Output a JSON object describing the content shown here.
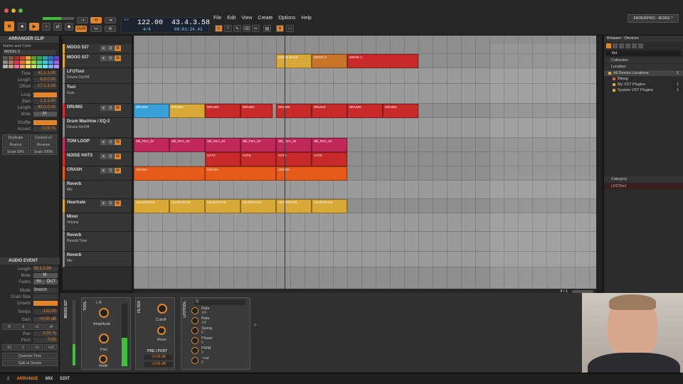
{
  "transport": {
    "tempo": "122.00",
    "signature": "4/4",
    "position": "43.4.3.58",
    "time": "00:01:24.41",
    "ovr": "OVR"
  },
  "menu": [
    "File",
    "Edit",
    "View",
    "Create",
    "Options",
    "Help"
  ],
  "project": {
    "name": "FADERPRO - BORG *"
  },
  "inspector": {
    "title": "ARRANGER CLIP",
    "name_color_label": "Name and Color",
    "clip_name": "MOOG 2",
    "fields": [
      {
        "k": "Time",
        "v": "41.1.1.00"
      },
      {
        "k": "Length",
        "v": "8.0.0.00"
      },
      {
        "k": "Offset",
        "v": "17.1.1.00"
      }
    ],
    "loop": [
      {
        "k": "Loop",
        "v": ""
      },
      {
        "k": "Start",
        "v": "1.1.1.00"
      },
      {
        "k": "Length",
        "v": "40.0.0.00"
      }
    ],
    "mute_label": "Mute",
    "mute_val": "M",
    "shuffle_label": "Shuffle",
    "accent_label": "Accent",
    "accent_val": "0.00 %",
    "buttons": [
      "Duplicate",
      "Content x2",
      "Bounce",
      "Reverse",
      "Scale 50%",
      "Scale 200%"
    ]
  },
  "audio_event": {
    "title": "AUDIO EVENT",
    "length_label": "Length",
    "length": "39.3.3.99",
    "mute_label": "Mute",
    "fades_label": "Fades",
    "fades_in": "IN",
    "fades_out": "OUT",
    "mode_label": "Mode",
    "mode": "Stretch",
    "grain_label": "Grain Size",
    "onsets_label": "Onsets",
    "tempo_label": "Tempo",
    "tempo": "122.00",
    "gain_label": "Gain",
    "gain": "+0.00 dB",
    "gain_steps": [
      "-6",
      "-1",
      "+1",
      "+6"
    ],
    "pan_label": "Pan",
    "pan": "0.00 %",
    "pitch_label": "Pitch",
    "pitch": "0.00",
    "pitch_steps": [
      "-12",
      "-1",
      "+1",
      "+12"
    ],
    "quantize": "Quantize Time",
    "split": "Split at Onsets"
  },
  "ruler": [
    "1",
    "5",
    "9",
    "13",
    "17",
    "21",
    "25",
    "29",
    "33",
    "37",
    "41",
    "45",
    "49",
    "53",
    "57",
    "61",
    "65",
    "69",
    "73",
    "77",
    "81",
    "85",
    "89",
    "93",
    "97",
    "101",
    "105",
    "109",
    "113",
    "117",
    "121",
    "125",
    "129"
  ],
  "tracks": [
    {
      "name": "MOOG 537",
      "sub": "",
      "h": 14,
      "color": "#d8a838"
    },
    {
      "name": "MOOG 537",
      "sub": "",
      "h": 20,
      "color": "#d8a838"
    },
    {
      "name": "LFOTool",
      "sub": "Device On/Off",
      "h": 22,
      "color": "#888"
    },
    {
      "name": "Tool",
      "sub": "Gain",
      "h": 28,
      "color": "#888"
    },
    {
      "name": "DRUMS",
      "sub": "",
      "h": 20,
      "color": "#d83030"
    },
    {
      "name": "Drum Machine / EQ-2",
      "sub": "Device On/Off",
      "h": 28,
      "color": "#888"
    },
    {
      "name": "TOM LOOP",
      "sub": "",
      "h": 20,
      "color": "#d02a6a"
    },
    {
      "name": "NOISE HATS",
      "sub": "",
      "h": 20,
      "color": "#d83030"
    },
    {
      "name": "CRASH",
      "sub": "",
      "h": 20,
      "color": "#e85a1a"
    },
    {
      "name": "Reverb",
      "sub": "Mix",
      "h": 26,
      "color": "#888"
    },
    {
      "name": "Heartrate",
      "sub": "",
      "h": 20,
      "color": "#d8a838"
    },
    {
      "name": "Mixer",
      "sub": "Volume",
      "h": 26,
      "color": "#888"
    },
    {
      "name": "Reverb",
      "sub": "Reverb Time",
      "h": 28,
      "color": "#888"
    },
    {
      "name": "Reverb",
      "sub": "Mix",
      "h": 22,
      "color": "#888"
    }
  ],
  "clips": [
    {
      "label": "MOOG BASS",
      "track": 1,
      "start": 41,
      "len": 10,
      "color": "#d8a838"
    },
    {
      "label": "MOOG 2",
      "track": 1,
      "start": 51,
      "len": 10,
      "color": "#c8742a"
    },
    {
      "label": "MOOG 1",
      "track": 1,
      "start": 61,
      "len": 20,
      "color": "#c82a2a"
    },
    {
      "label": "DRUMS",
      "track": 4,
      "start": 1,
      "len": 10,
      "color": "#3aa0d8"
    },
    {
      "label": "DRUMS",
      "track": 4,
      "start": 11,
      "len": 10,
      "color": "#d8a838"
    },
    {
      "label": "DRUMS",
      "track": 4,
      "start": 21,
      "len": 10,
      "color": "#c82a2a"
    },
    {
      "label": "DRUMS",
      "track": 4,
      "start": 31,
      "len": 9,
      "color": "#c82a2a"
    },
    {
      "label": "DRUMS",
      "track": 4,
      "start": 41,
      "len": 10,
      "color": "#c82a2a"
    },
    {
      "label": "DRUMS",
      "track": 4,
      "start": 51,
      "len": 10,
      "color": "#c82a2a"
    },
    {
      "label": "DRUMS",
      "track": 4,
      "start": 61,
      "len": 10,
      "color": "#c82a2a"
    },
    {
      "label": "DRUMS",
      "track": 4,
      "start": 71,
      "len": 10,
      "color": "#c82a2a"
    },
    {
      "label": "Slk_Perc_04",
      "track": 6,
      "start": 1,
      "len": 10,
      "color": "#c0285a"
    },
    {
      "label": "Slk_Perc_04",
      "track": 6,
      "start": 11,
      "len": 10,
      "color": "#c0285a"
    },
    {
      "label": "Slk_Perc_04",
      "track": 6,
      "start": 21,
      "len": 10,
      "color": "#c0285a"
    },
    {
      "label": "Slk_Perc_04",
      "track": 6,
      "start": 31,
      "len": 10,
      "color": "#c0285a"
    },
    {
      "label": "Slk_Perc_04",
      "track": 6,
      "start": 41,
      "len": 10,
      "color": "#c0285a"
    },
    {
      "label": "Slk_Perc_04",
      "track": 6,
      "start": 51,
      "len": 10,
      "color": "#c0285a"
    },
    {
      "label": "HATS",
      "track": 7,
      "start": 21,
      "len": 10,
      "color": "#c82a2a"
    },
    {
      "label": "HATS",
      "track": 7,
      "start": 31,
      "len": 10,
      "color": "#c82a2a"
    },
    {
      "label": "HATS",
      "track": 7,
      "start": 41,
      "len": 10,
      "color": "#c82a2a"
    },
    {
      "label": "HATS",
      "track": 7,
      "start": 51,
      "len": 10,
      "color": "#c82a2a"
    },
    {
      "label": "CRASH",
      "track": 8,
      "start": 1,
      "len": 20,
      "color": "#e85a1a"
    },
    {
      "label": "CRASH",
      "track": 8,
      "start": 21,
      "len": 20,
      "color": "#e85a1a"
    },
    {
      "label": "CRASH",
      "track": 8,
      "start": 41,
      "len": 20,
      "color": "#e85a1a"
    },
    {
      "label": "HEARTRATE",
      "track": 10,
      "start": 1,
      "len": 10,
      "color": "#d8a838"
    },
    {
      "label": "HEARTRATE",
      "track": 10,
      "start": 11,
      "len": 10,
      "color": "#d8a838"
    },
    {
      "label": "HEARTRATE",
      "track": 10,
      "start": 21,
      "len": 10,
      "color": "#d8a838"
    },
    {
      "label": "HEARTRATE",
      "track": 10,
      "start": 31,
      "len": 10,
      "color": "#d8a838"
    },
    {
      "label": "HEARTRATE",
      "track": 10,
      "start": 41,
      "len": 10,
      "color": "#d8a838"
    },
    {
      "label": "HEARTRATE",
      "track": 10,
      "start": 51,
      "len": 10,
      "color": "#d8a838"
    }
  ],
  "browser": {
    "title": "Browser - Devices",
    "search": "lfot",
    "sections": [
      "Collection",
      "Location"
    ],
    "items": [
      {
        "label": "All Device Locations",
        "count": "1"
      },
      {
        "label": "Bitwig",
        "count": ""
      },
      {
        "label": "My VST Plugins",
        "count": "1"
      },
      {
        "label": "System VST Plugins",
        "count": "1"
      }
    ],
    "category": "Category",
    "result": "LFOTool"
  },
  "device_chain": {
    "track": "MOOG 537",
    "tool": {
      "title": "TOOL",
      "amp": "Amplitude",
      "pan": "Pan",
      "width": "Width",
      "mode": "L R"
    },
    "filter": {
      "title": "FILTER",
      "cutoff": "Cutoff",
      "reso": "Reso",
      "prepost": "PRE / POST",
      "db1": "+0.00 dB",
      "db2": "+0.00 dB"
    },
    "lfotool": {
      "title": "LFOTOOL",
      "search": "Q-",
      "params": [
        {
          "k": "Rate",
          "v": "1/4"
        },
        {
          "k": "Rate",
          "v": "1/4"
        },
        {
          "k": "Swing",
          "v": "0"
        },
        {
          "k": "Phase",
          "v": "0"
        },
        {
          "k": "PWM",
          "v": "0"
        },
        {
          "k": "~cut",
          "v": "0"
        }
      ]
    }
  },
  "status": {
    "tabs": [
      "ARRANGE",
      "MIX",
      "EDIT"
    ],
    "page": "4 / 1"
  },
  "colors": {
    "accent": "#e2852a",
    "lcd": "#8ed2ff"
  }
}
